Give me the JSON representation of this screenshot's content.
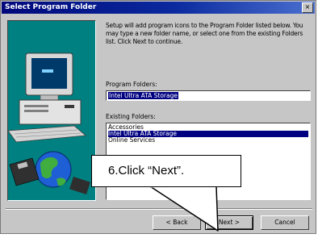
{
  "dialog": {
    "title": "Select Program Folder",
    "close_label": "×",
    "description": "Setup will add program icons to the Program Folder listed below. You may type a new folder name, or select one from the existing Folders list. Click Next to continue.",
    "program_folder_label": "Program Folders:",
    "program_folder_value": "Intel Ultra ATA Storage",
    "existing_folders_label": "Existing Folders:",
    "existing_folders": [
      "Accessories",
      "Intel Ultra ATA Storage",
      "Online Services"
    ],
    "selected_folder_index": 1,
    "buttons": {
      "back": "< Back",
      "next": "Next >",
      "cancel": "Cancel"
    }
  },
  "callout": {
    "text": "6.Click “Next”."
  },
  "colors": {
    "title_start": "#00087b",
    "title_end": "#4b6fcf",
    "art_bg": "#008080",
    "selection": "#000080"
  },
  "icons": [
    "computer-illustration",
    "globe-icon",
    "disk-icon",
    "close-icon"
  ]
}
